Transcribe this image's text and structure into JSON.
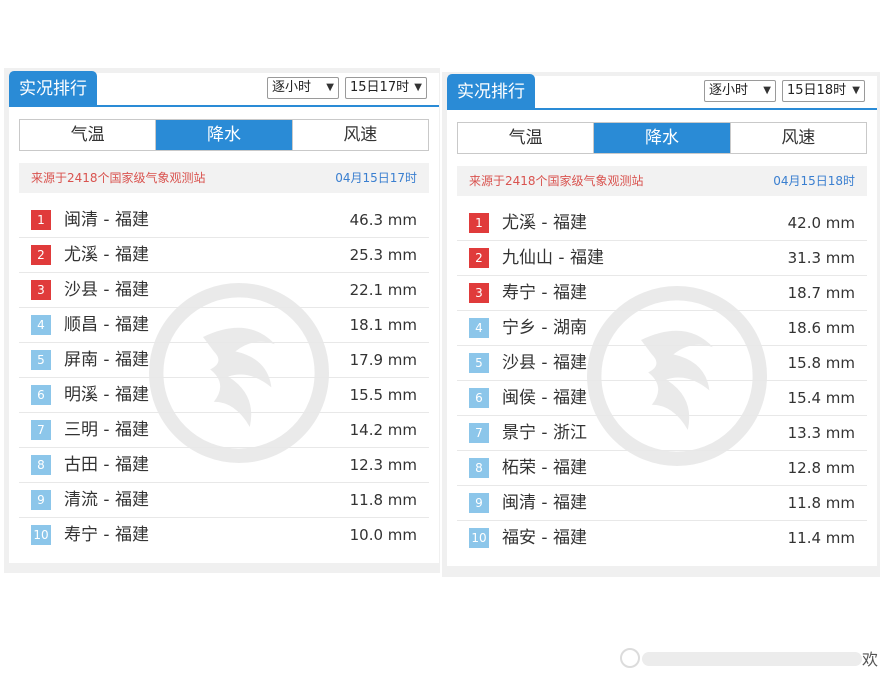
{
  "panels": [
    {
      "title": "实况排行",
      "select_mode": "逐小时",
      "select_time": "15日17时",
      "tabs": [
        "气温",
        "降水",
        "风速"
      ],
      "active_tab": 1,
      "source_text": "来源于2418个国家级气象观测站",
      "source_time": "04月15日17时",
      "rows": [
        {
          "rank": "1",
          "name": "闽清 - 福建",
          "value": "46.3 mm"
        },
        {
          "rank": "2",
          "name": "尤溪 - 福建",
          "value": "25.3 mm"
        },
        {
          "rank": "3",
          "name": "沙县 - 福建",
          "value": "22.1 mm"
        },
        {
          "rank": "4",
          "name": "顺昌 - 福建",
          "value": "18.1 mm"
        },
        {
          "rank": "5",
          "name": "屏南 - 福建",
          "value": "17.9 mm"
        },
        {
          "rank": "6",
          "name": "明溪 - 福建",
          "value": "15.5 mm"
        },
        {
          "rank": "7",
          "name": "三明 - 福建",
          "value": "14.2 mm"
        },
        {
          "rank": "8",
          "name": "古田 - 福建",
          "value": "12.3 mm"
        },
        {
          "rank": "9",
          "name": "清流 - 福建",
          "value": "11.8 mm"
        },
        {
          "rank": "10",
          "name": "寿宁 - 福建",
          "value": "10.0 mm"
        }
      ]
    },
    {
      "title": "实况排行",
      "select_mode": "逐小时",
      "select_time": "15日18时",
      "tabs": [
        "气温",
        "降水",
        "风速"
      ],
      "active_tab": 1,
      "source_text": "来源于2418个国家级气象观测站",
      "source_time": "04月15日18时",
      "rows": [
        {
          "rank": "1",
          "name": "尤溪 - 福建",
          "value": "42.0 mm"
        },
        {
          "rank": "2",
          "name": "九仙山 - 福建",
          "value": "31.3 mm"
        },
        {
          "rank": "3",
          "name": "寿宁 - 福建",
          "value": "18.7 mm"
        },
        {
          "rank": "4",
          "name": "宁乡 - 湖南",
          "value": "18.6 mm"
        },
        {
          "rank": "5",
          "name": "沙县 - 福建",
          "value": "15.8 mm"
        },
        {
          "rank": "6",
          "name": "闽侯 - 福建",
          "value": "15.4 mm"
        },
        {
          "rank": "7",
          "name": "景宁 - 浙江",
          "value": "13.3 mm"
        },
        {
          "rank": "8",
          "name": "柘荣 - 福建",
          "value": "12.8 mm"
        },
        {
          "rank": "9",
          "name": "闽清 - 福建",
          "value": "11.8 mm"
        },
        {
          "rank": "10",
          "name": "福安 - 福建",
          "value": "11.4 mm"
        }
      ]
    }
  ],
  "corner_watermark_char": "欢",
  "colors": {
    "accent": "#2a8bd6",
    "rank_top": "#e03b3b",
    "rank_rest": "#8cc6ea",
    "source_text": "#d9534f",
    "source_time": "#3a7fd0"
  },
  "icons": {
    "select_arrow": "chevron-down-icon",
    "watermark": "dragon-watermark-icon"
  }
}
